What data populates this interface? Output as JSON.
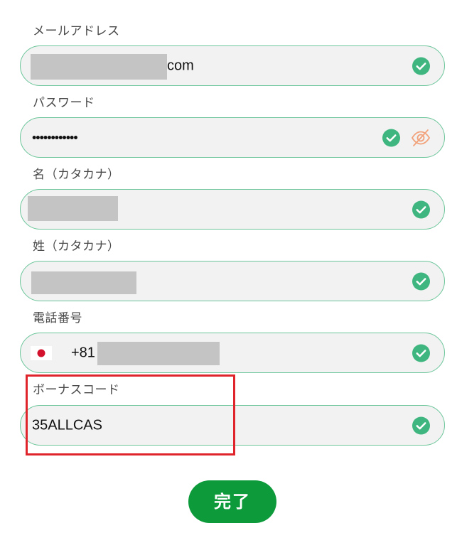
{
  "form": {
    "email": {
      "label": "メールアドレス",
      "value_suffix": "com",
      "valid": true
    },
    "password": {
      "label": "パスワード",
      "value": "••••••••••••",
      "valid": true,
      "visibility_icon": "eye-off-icon"
    },
    "first_name_kana": {
      "label": "名（カタカナ）",
      "valid": true
    },
    "last_name_kana": {
      "label": "姓（カタカナ）",
      "valid": true
    },
    "phone": {
      "label": "電話番号",
      "country_flag": "japan-flag-icon",
      "country_code": "+81",
      "valid": true
    },
    "bonus_code": {
      "label": "ボーナスコード",
      "value": "35ALLCAS",
      "valid": true
    }
  },
  "submit_label": "完了",
  "colors": {
    "field_border": "#6cc69b",
    "field_background": "#f2f2f2",
    "check_green": "#3fb67f",
    "eye_icon": "#f2a27a",
    "button_green": "#0d9a3b",
    "highlight_red": "#e0242b",
    "redaction_gray": "#c4c4c4"
  },
  "icons": {
    "valid": "check-circle-icon",
    "password_toggle": "eye-off-icon",
    "flag": "japan-flag-icon"
  }
}
